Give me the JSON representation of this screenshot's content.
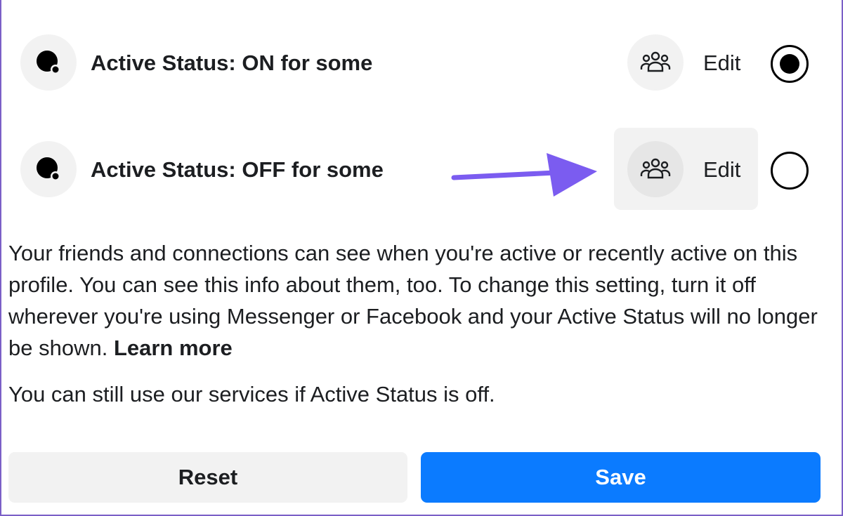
{
  "options": [
    {
      "label": "Active Status: ON for some",
      "edit_label": "Edit",
      "selected": true,
      "status_icon": "active-status-icon",
      "audience_icon": "people-group-icon"
    },
    {
      "label": "Active Status: OFF for some",
      "edit_label": "Edit",
      "selected": false,
      "status_icon": "active-status-icon",
      "audience_icon": "people-group-icon"
    }
  ],
  "description": {
    "text": "Your friends and connections can see when you're active or recently active on this profile. You can see this info about them, too. To change this setting, turn it off wherever you're using Messenger or Facebook and your Active Status will no longer be shown.",
    "link_label": "Learn more"
  },
  "note": "You can still use our services if Active Status is off.",
  "buttons": {
    "reset_label": "Reset",
    "save_label": "Save"
  },
  "colors": {
    "accent": "#0b7bff",
    "annotation_arrow": "#7b5cf0",
    "frame_border": "#7b5fc7"
  }
}
